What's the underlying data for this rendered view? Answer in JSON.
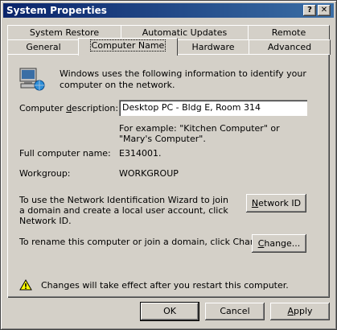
{
  "window": {
    "title": "System Properties",
    "help_label": "?",
    "close_label": "✕"
  },
  "tabs_row_back": [
    "System Restore",
    "Automatic Updates",
    "Remote"
  ],
  "tabs_row_front": [
    "General",
    "Computer Name",
    "Hardware",
    "Advanced"
  ],
  "selected_tab": "Computer Name",
  "intro": "Windows uses the following information to identify your computer on the network.",
  "description": {
    "label": "Computer description:",
    "value": "Desktop PC - Bldg E, Room 314"
  },
  "example": "For example: \"Kitchen Computer\" or \"Mary's Computer\".",
  "full_name": {
    "label": "Full computer name:",
    "value": "E314001."
  },
  "workgroup": {
    "label": "Workgroup:",
    "value": "WORKGROUP"
  },
  "network_id": {
    "text": "To use the Network Identification Wizard to join a domain and create a local user account, click Network ID.",
    "button": "Network ID"
  },
  "change": {
    "text": "To rename this computer or join a domain, click Change.",
    "button": "Change..."
  },
  "warning": "Changes will take effect after you restart this computer.",
  "footer": {
    "ok": "OK",
    "cancel": "Cancel",
    "apply": "Apply"
  },
  "icons": {
    "computer": "computer-network-icon",
    "warning": "warning-icon"
  }
}
